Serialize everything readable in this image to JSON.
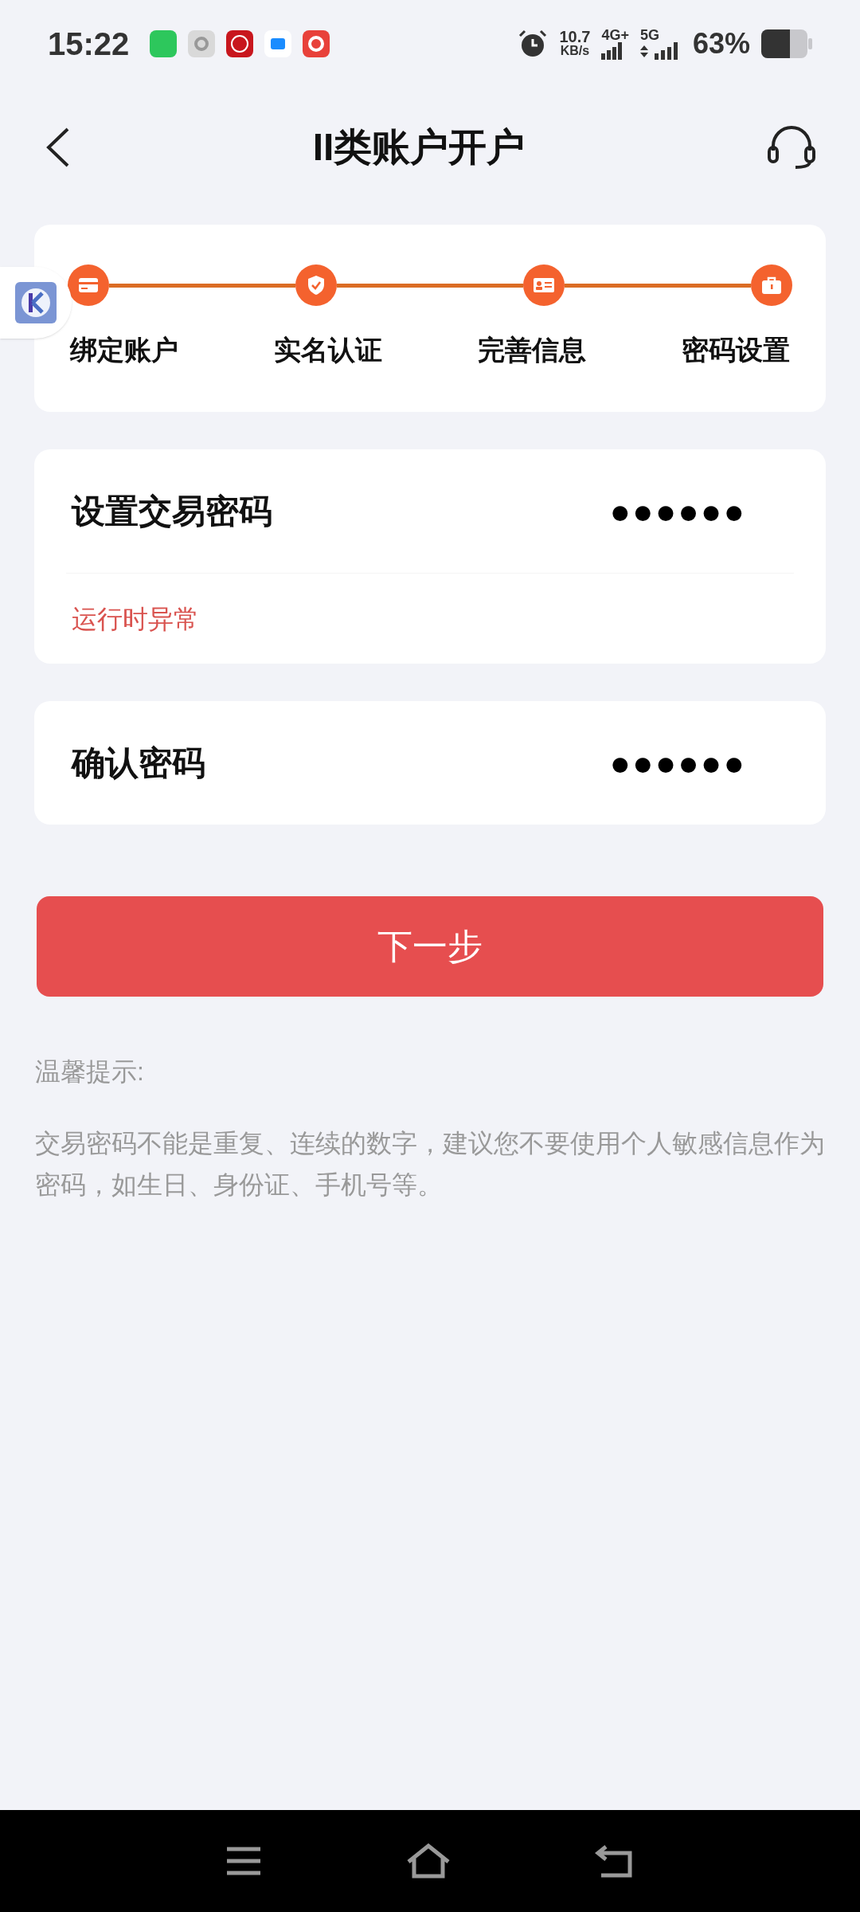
{
  "status_bar": {
    "time": "15:22",
    "speed": "10.7",
    "speed_unit": "KB/s",
    "network_1": "4G+",
    "network_2": "5G",
    "battery": "63%"
  },
  "header": {
    "title": "II类账户开户"
  },
  "steps": [
    {
      "label": "绑定账户",
      "completed": true,
      "kind": "card"
    },
    {
      "label": "实名认证",
      "completed": true,
      "kind": "shield"
    },
    {
      "label": "完善信息",
      "completed": true,
      "kind": "id"
    },
    {
      "label": "密码设置",
      "completed": true,
      "kind": "lock"
    }
  ],
  "fields": [
    {
      "label": "设置交易密码",
      "value": "●●●●●●",
      "error": "运行时异常"
    },
    {
      "label": "确认密码",
      "value": "●●●●●●"
    }
  ],
  "next_button": {
    "label": "下一步"
  },
  "tips": {
    "title": "温馨提示:",
    "text": "交易密码不能是重复、连续的数字，建议您不要使用个人敏感信息作为密码，如生日、身份证、手机号等。"
  }
}
